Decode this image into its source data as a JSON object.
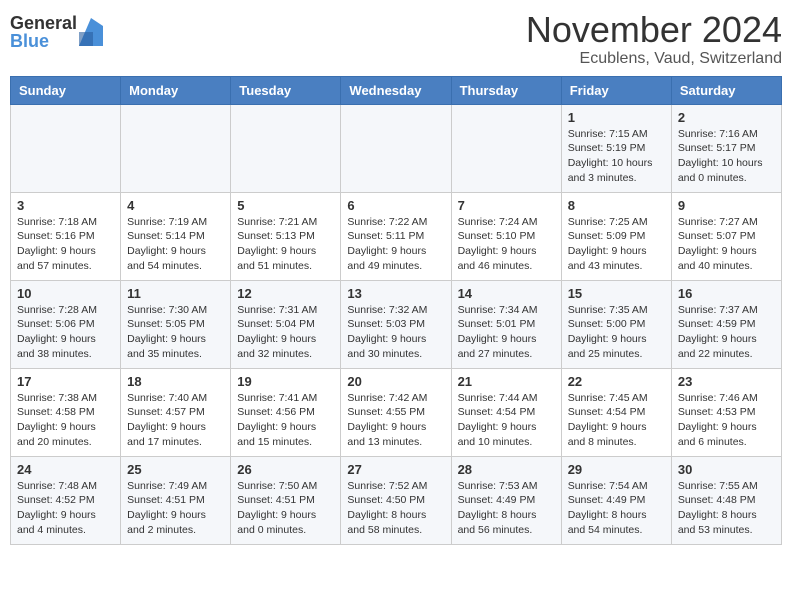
{
  "logo": {
    "general": "General",
    "blue": "Blue"
  },
  "title": "November 2024",
  "location": "Ecublens, Vaud, Switzerland",
  "days_of_week": [
    "Sunday",
    "Monday",
    "Tuesday",
    "Wednesday",
    "Thursday",
    "Friday",
    "Saturday"
  ],
  "weeks": [
    [
      {
        "day": "",
        "info": ""
      },
      {
        "day": "",
        "info": ""
      },
      {
        "day": "",
        "info": ""
      },
      {
        "day": "",
        "info": ""
      },
      {
        "day": "",
        "info": ""
      },
      {
        "day": "1",
        "info": "Sunrise: 7:15 AM\nSunset: 5:19 PM\nDaylight: 10 hours\nand 3 minutes."
      },
      {
        "day": "2",
        "info": "Sunrise: 7:16 AM\nSunset: 5:17 PM\nDaylight: 10 hours\nand 0 minutes."
      }
    ],
    [
      {
        "day": "3",
        "info": "Sunrise: 7:18 AM\nSunset: 5:16 PM\nDaylight: 9 hours\nand 57 minutes."
      },
      {
        "day": "4",
        "info": "Sunrise: 7:19 AM\nSunset: 5:14 PM\nDaylight: 9 hours\nand 54 minutes."
      },
      {
        "day": "5",
        "info": "Sunrise: 7:21 AM\nSunset: 5:13 PM\nDaylight: 9 hours\nand 51 minutes."
      },
      {
        "day": "6",
        "info": "Sunrise: 7:22 AM\nSunset: 5:11 PM\nDaylight: 9 hours\nand 49 minutes."
      },
      {
        "day": "7",
        "info": "Sunrise: 7:24 AM\nSunset: 5:10 PM\nDaylight: 9 hours\nand 46 minutes."
      },
      {
        "day": "8",
        "info": "Sunrise: 7:25 AM\nSunset: 5:09 PM\nDaylight: 9 hours\nand 43 minutes."
      },
      {
        "day": "9",
        "info": "Sunrise: 7:27 AM\nSunset: 5:07 PM\nDaylight: 9 hours\nand 40 minutes."
      }
    ],
    [
      {
        "day": "10",
        "info": "Sunrise: 7:28 AM\nSunset: 5:06 PM\nDaylight: 9 hours\nand 38 minutes."
      },
      {
        "day": "11",
        "info": "Sunrise: 7:30 AM\nSunset: 5:05 PM\nDaylight: 9 hours\nand 35 minutes."
      },
      {
        "day": "12",
        "info": "Sunrise: 7:31 AM\nSunset: 5:04 PM\nDaylight: 9 hours\nand 32 minutes."
      },
      {
        "day": "13",
        "info": "Sunrise: 7:32 AM\nSunset: 5:03 PM\nDaylight: 9 hours\nand 30 minutes."
      },
      {
        "day": "14",
        "info": "Sunrise: 7:34 AM\nSunset: 5:01 PM\nDaylight: 9 hours\nand 27 minutes."
      },
      {
        "day": "15",
        "info": "Sunrise: 7:35 AM\nSunset: 5:00 PM\nDaylight: 9 hours\nand 25 minutes."
      },
      {
        "day": "16",
        "info": "Sunrise: 7:37 AM\nSunset: 4:59 PM\nDaylight: 9 hours\nand 22 minutes."
      }
    ],
    [
      {
        "day": "17",
        "info": "Sunrise: 7:38 AM\nSunset: 4:58 PM\nDaylight: 9 hours\nand 20 minutes."
      },
      {
        "day": "18",
        "info": "Sunrise: 7:40 AM\nSunset: 4:57 PM\nDaylight: 9 hours\nand 17 minutes."
      },
      {
        "day": "19",
        "info": "Sunrise: 7:41 AM\nSunset: 4:56 PM\nDaylight: 9 hours\nand 15 minutes."
      },
      {
        "day": "20",
        "info": "Sunrise: 7:42 AM\nSunset: 4:55 PM\nDaylight: 9 hours\nand 13 minutes."
      },
      {
        "day": "21",
        "info": "Sunrise: 7:44 AM\nSunset: 4:54 PM\nDaylight: 9 hours\nand 10 minutes."
      },
      {
        "day": "22",
        "info": "Sunrise: 7:45 AM\nSunset: 4:54 PM\nDaylight: 9 hours\nand 8 minutes."
      },
      {
        "day": "23",
        "info": "Sunrise: 7:46 AM\nSunset: 4:53 PM\nDaylight: 9 hours\nand 6 minutes."
      }
    ],
    [
      {
        "day": "24",
        "info": "Sunrise: 7:48 AM\nSunset: 4:52 PM\nDaylight: 9 hours\nand 4 minutes."
      },
      {
        "day": "25",
        "info": "Sunrise: 7:49 AM\nSunset: 4:51 PM\nDaylight: 9 hours\nand 2 minutes."
      },
      {
        "day": "26",
        "info": "Sunrise: 7:50 AM\nSunset: 4:51 PM\nDaylight: 9 hours\nand 0 minutes."
      },
      {
        "day": "27",
        "info": "Sunrise: 7:52 AM\nSunset: 4:50 PM\nDaylight: 8 hours\nand 58 minutes."
      },
      {
        "day": "28",
        "info": "Sunrise: 7:53 AM\nSunset: 4:49 PM\nDaylight: 8 hours\nand 56 minutes."
      },
      {
        "day": "29",
        "info": "Sunrise: 7:54 AM\nSunset: 4:49 PM\nDaylight: 8 hours\nand 54 minutes."
      },
      {
        "day": "30",
        "info": "Sunrise: 7:55 AM\nSunset: 4:48 PM\nDaylight: 8 hours\nand 53 minutes."
      }
    ]
  ]
}
